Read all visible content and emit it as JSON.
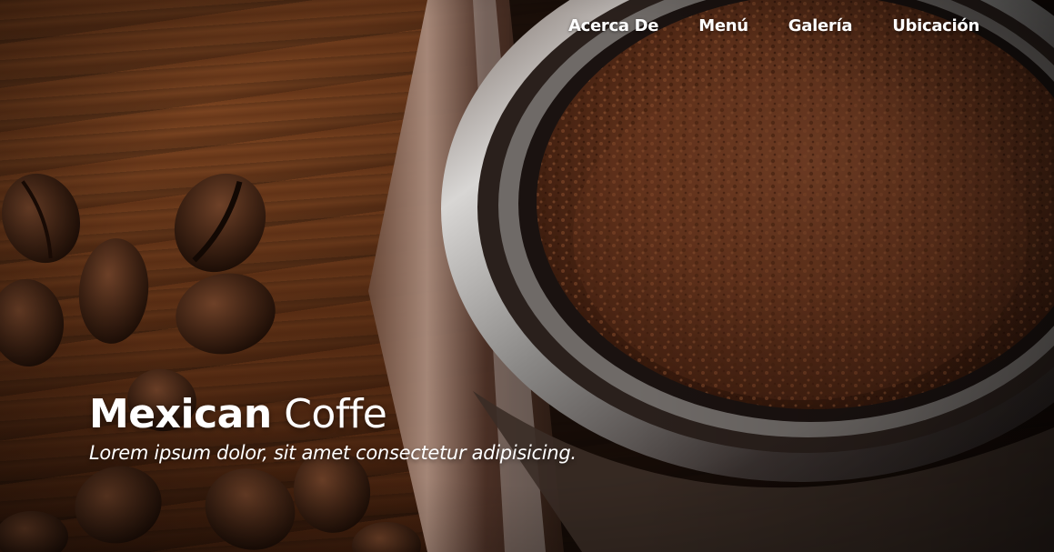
{
  "nav": {
    "items": [
      {
        "label": "Acerca De"
      },
      {
        "label": "Menú"
      },
      {
        "label": "Galería"
      },
      {
        "label": "Ubicación"
      }
    ]
  },
  "hero": {
    "title_strong": "Mexican",
    "title_rest": "Coffe",
    "subtitle": "Lorem ipsum dolor, sit amet consectetur adipisicing."
  },
  "colors": {
    "text": "#ffffff",
    "wood_dark": "#3a1c0c",
    "coffee_ground": "#6b3a22",
    "metal": "#8a8886"
  }
}
